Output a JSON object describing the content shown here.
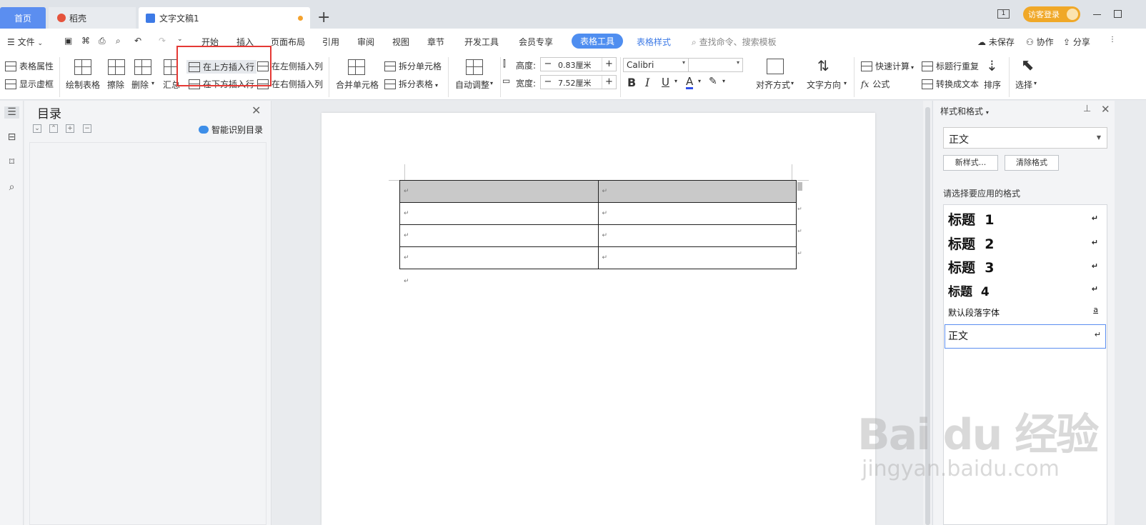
{
  "tabs": {
    "home": "首页",
    "daoke": "稻壳",
    "doc": "文字文稿1",
    "add": "+"
  },
  "window": {
    "login": "访客登录",
    "page_badge": "1"
  },
  "menu": {
    "file": "文件",
    "items": [
      "开始",
      "插入",
      "页面布局",
      "引用",
      "审阅",
      "视图",
      "章节",
      "开发工具",
      "会员专享"
    ],
    "table_tools": "表格工具",
    "table_style": "表格样式",
    "search_placeholder": "查找命令、搜索模板",
    "unsaved": "未保存",
    "collab": "协作",
    "share": "分享"
  },
  "ribbon": {
    "table_props": "表格属性",
    "show_gridlines": "显示虚框",
    "draw_table": "绘制表格",
    "erase": "擦除",
    "delete": "删除",
    "summary": "汇总",
    "insert_row_above": "在上方插入行",
    "insert_row_below": "在下方插入行",
    "insert_col_left": "在左侧插入列",
    "insert_col_right": "在右侧插入列",
    "merge_cells": "合并单元格",
    "split_cells": "拆分单元格",
    "split_table": "拆分表格",
    "auto_fit": "自动调整",
    "height_label": "高度:",
    "height_value": "0.83厘米",
    "width_label": "宽度:",
    "width_value": "7.52厘米",
    "font_name": "Calibri",
    "align": "对齐方式",
    "text_direction": "文字方向",
    "quick_calc": "快速计算",
    "repeat_header": "标题行重复",
    "formula": "公式",
    "to_text": "转换成文本",
    "sort": "排序",
    "select": "选择"
  },
  "toc": {
    "title": "目录",
    "smart": "智能识别目录"
  },
  "document": {
    "table_rows": [
      [
        "↵",
        "↵"
      ],
      [
        "↵",
        "↵"
      ],
      [
        "↵",
        "↵"
      ],
      [
        "↵",
        "↵"
      ]
    ],
    "para_mark": "↵"
  },
  "styles_panel": {
    "title": "样式和格式",
    "current_style": "正文",
    "new_style": "新样式...",
    "clear_format": "清除格式",
    "hint": "请选择要应用的格式",
    "items": [
      {
        "label": "标题  1",
        "mark": "↵"
      },
      {
        "label": "标题  2",
        "mark": "↵"
      },
      {
        "label": "标题  3",
        "mark": "↵"
      },
      {
        "label": "标题  4",
        "mark": "↵"
      },
      {
        "label": "默认段落字体",
        "mark": "a"
      },
      {
        "label": "正文",
        "mark": "↵"
      }
    ]
  },
  "watermark": {
    "logo": "Bai du 经验",
    "url": "jingyan.baidu.com"
  }
}
